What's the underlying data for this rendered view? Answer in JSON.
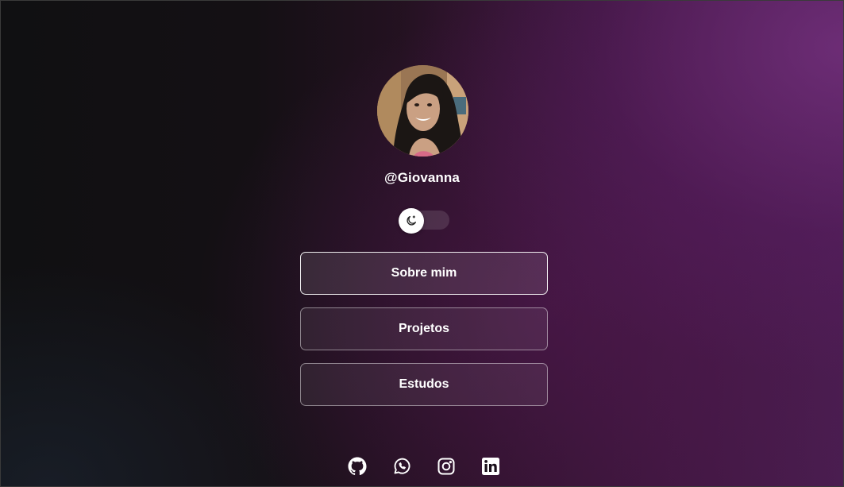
{
  "profile": {
    "username": "@Giovanna",
    "avatar_icon": "profile-photo"
  },
  "theme_toggle": {
    "icon": "moon-icon",
    "state": "dark"
  },
  "links": [
    {
      "label": "Sobre mim",
      "active": true
    },
    {
      "label": "Projetos",
      "active": false
    },
    {
      "label": "Estudos",
      "active": false
    }
  ],
  "socials": [
    {
      "icon": "github-icon"
    },
    {
      "icon": "whatsapp-icon"
    },
    {
      "icon": "instagram-icon"
    },
    {
      "icon": "linkedin-icon"
    }
  ],
  "colors": {
    "background_dark": "#101012",
    "background_purple": "#5a2a66",
    "text": "#ffffff"
  }
}
